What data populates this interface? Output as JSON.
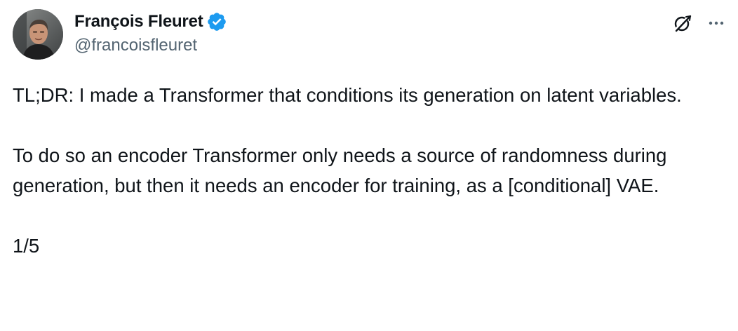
{
  "author": {
    "display_name": "François Fleuret",
    "handle": "@francoisfleuret",
    "verified": true,
    "verified_color": "#1d9bf0"
  },
  "icons": {
    "avatar": "profile-photo",
    "badge": "verified-badge-icon",
    "grok": "grok-icon",
    "more": "more-options-icon"
  },
  "tweet": {
    "paragraph_1": "TL;DR: I made a Transformer that conditions its generation on latent variables.",
    "paragraph_2": "To do so an encoder Transformer only needs a source of randomness during generation, but then it needs an encoder for training, as a [conditional] VAE.",
    "thread_position": "1/5"
  },
  "colors": {
    "text": "#0f1419",
    "secondary_text": "#536471",
    "background": "#ffffff"
  }
}
